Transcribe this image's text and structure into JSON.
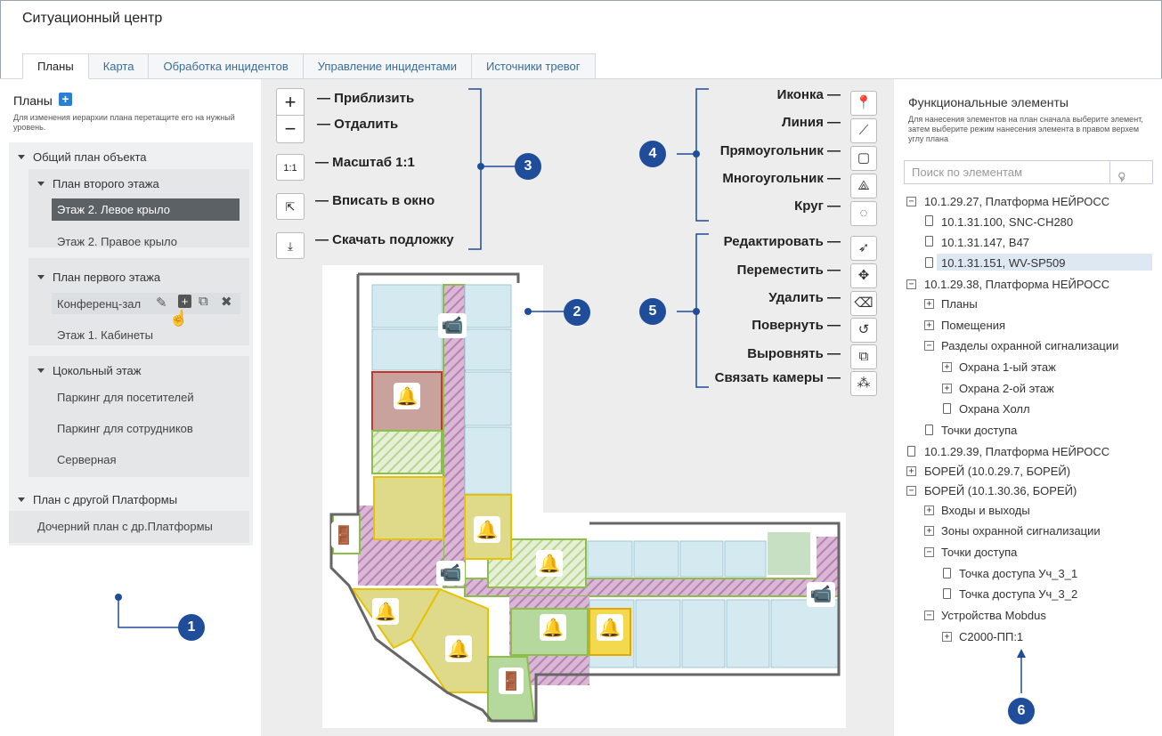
{
  "app_title": "Ситуационный центр",
  "tabs": [
    "Планы",
    "Карта",
    "Обработка инцидентов",
    "Управление инцидентами",
    "Источники тревог"
  ],
  "left": {
    "heading": "Планы",
    "hint": "Для изменения иерархии плана перетащите его на нужный уровень.",
    "root": "Общий план объекта",
    "groups": [
      {
        "title": "План второго этажа",
        "items": [
          "Этаж 2. Левое крыло",
          "Этаж 2. Правое крыло"
        ]
      },
      {
        "title": "План первого этажа",
        "items": [
          "Конференц-зал",
          "Этаж 1. Кабинеты"
        ]
      },
      {
        "title": "Цокольный этаж",
        "items": [
          "Паркинг для посетителей",
          "Паркинг для сотрудников",
          "Серверная"
        ]
      }
    ],
    "other_root": "План с другой Платформы",
    "other_child": "Дочерний план с др.Платформы"
  },
  "map_controls": {
    "zoom_in": "— Приблизить",
    "zoom_out": "— Отдалить",
    "scale": "— Масштаб 1:1",
    "scale_btn": "1:1",
    "fit": "— Вписать в окно",
    "download": "— Скачать подложку"
  },
  "draw_tools": [
    "Иконка —",
    "Линия —",
    "Прямоугольник —",
    "Многоугольник —",
    "Круг —"
  ],
  "edit_tools": [
    "Редактировать —",
    "Переместить —",
    "Удалить —",
    "Повернуть —",
    "Выровнять —",
    "Связать камеры —"
  ],
  "badges": [
    "1",
    "2",
    "3",
    "4",
    "5",
    "6"
  ],
  "right": {
    "title": "Функциональные элементы",
    "hint": "Для нанесения элементов на план сначала выберите элемент, затем выберите режим нанесения элемента в правом верхем углу плана",
    "search_placeholder": "Поиск по элементам",
    "tree": [
      "10.1.29.27, Платформа НЕЙРОСС",
      "10.1.31.100, SNC-CH280",
      "10.1.31.147, B47",
      "10.1.31.151, WV-SP509",
      "10.1.29.38, Платформа НЕЙРОСС",
      "Планы",
      "Помещения",
      "Разделы охранной сигнализации",
      "Охрана 1-ый этаж",
      "Охрана 2-ой этаж",
      "Охрана Холл",
      "Точки доступа",
      "10.1.29.39, Платформа НЕЙРОСС",
      "БОРЕЙ (10.0.29.7, БОРЕЙ)",
      "БОРЕЙ (10.1.30.36, БОРЕЙ)",
      "Входы и выходы",
      "Зоны охранной сигнализации",
      "Точки доступа",
      "Точка доступа Уч_3_1",
      "Точка доступа Уч_3_2",
      "Устройства Mobdus",
      "С2000-ПП:1"
    ]
  },
  "colors": {
    "accent": "#2a7fd4",
    "badge": "#1f4d9a",
    "selected": "#5c6166"
  }
}
